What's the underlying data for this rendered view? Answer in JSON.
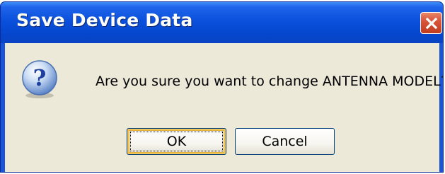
{
  "dialog": {
    "title": "Save Device Data",
    "message": "Are you sure you want to change ANTENNA MODEL?",
    "icon": "question-icon",
    "buttons": {
      "ok_label": "OK",
      "cancel_label": "Cancel"
    },
    "close_icon": "close-icon"
  },
  "colors": {
    "titlebar": "#0a50dc",
    "close_button": "#d8553a",
    "body": "#ece9d8"
  }
}
